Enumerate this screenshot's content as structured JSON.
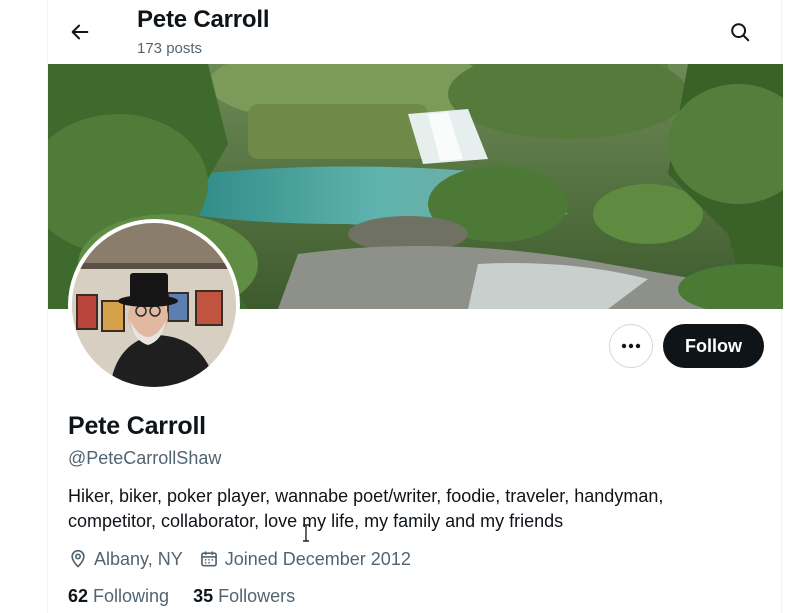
{
  "header": {
    "name": "Pete Carroll",
    "posts": "173 posts"
  },
  "actions": {
    "follow_label": "Follow"
  },
  "profile": {
    "name": "Pete Carroll",
    "handle": "@PeteCarrollShaw",
    "bio_line1": "Hiker, biker, poker player, wannabe poet/writer, foodie, traveler, handyman,",
    "bio_line2": "competitor, collaborator, love my life, my family and my friends",
    "location": "Albany, NY",
    "joined": "Joined December 2012"
  },
  "stats": {
    "following_count": "62",
    "following_label": "Following",
    "followers_count": "35",
    "followers_label": "Followers"
  },
  "icons": {
    "back": "arrow-left-icon",
    "search": "search-icon",
    "more": "more-horizontal-icon",
    "location": "location-pin-icon",
    "calendar": "calendar-icon"
  },
  "colors": {
    "text": "#0f1419",
    "secondary": "#536471",
    "follow_bg": "#0f1419",
    "border": "#cfd9de"
  }
}
